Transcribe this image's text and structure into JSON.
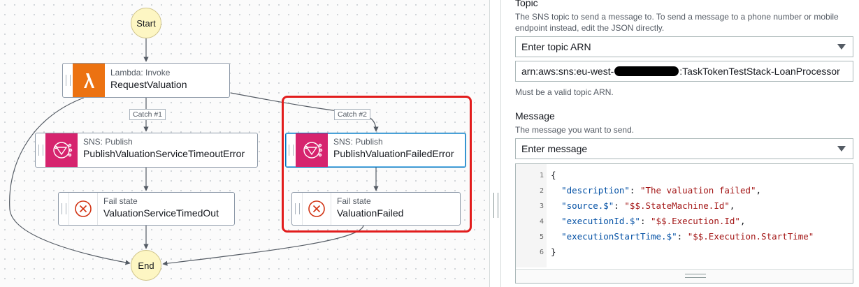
{
  "workflow": {
    "start_label": "Start",
    "end_label": "End",
    "nodes": [
      {
        "type": "Lambda: Invoke",
        "name": "RequestValuation",
        "icon": "lambda-icon"
      },
      {
        "type": "SNS: Publish",
        "name": "PublishValuationServiceTimeoutError",
        "icon": "sns-icon"
      },
      {
        "type": "SNS: Publish",
        "name": "PublishValuationFailedError",
        "icon": "sns-icon",
        "selected": true
      },
      {
        "type": "Fail state",
        "name": "ValuationServiceTimedOut",
        "icon": "fail-x-icon"
      },
      {
        "type": "Fail state",
        "name": "ValuationFailed",
        "icon": "fail-x-icon"
      }
    ],
    "catch_labels": [
      "Catch #1",
      "Catch #2"
    ],
    "highlight_color": "#e21c1c"
  },
  "form": {
    "topic": {
      "label": "Topic",
      "description": "The SNS topic to send a message to. To send a message to a phone number or mobile endpoint instead, edit the JSON directly.",
      "mode": "Enter topic ARN",
      "arn_prefix": "arn:aws:sns:eu-west-",
      "arn_suffix": ":TaskTokenTestStack-LoanProcessor",
      "hint": "Must be a valid topic ARN."
    },
    "message": {
      "label": "Message",
      "description": "The message you want to send.",
      "mode": "Enter message",
      "code_lines": [
        {
          "n": "1",
          "key": "",
          "value": "",
          "raw": "{"
        },
        {
          "n": "2",
          "key": "\"description\"",
          "value": "\"The valuation failed\"",
          "trail": ","
        },
        {
          "n": "3",
          "key": "\"source.$\"",
          "value": "\"$$.StateMachine.Id\"",
          "trail": ","
        },
        {
          "n": "4",
          "key": "\"executionId.$\"",
          "value": "\"$$.Execution.Id\"",
          "trail": ","
        },
        {
          "n": "5",
          "key": "\"executionStartTime.$\"",
          "value": "\"$$.Execution.StartTime\"",
          "trail": ""
        },
        {
          "n": "6",
          "key": "",
          "value": "",
          "raw": "}"
        }
      ]
    }
  },
  "colors": {
    "lambda": "#ec7211",
    "sns": "#d6246e",
    "circle_fill": "#fdf6c3",
    "selected_border": "#0073bb"
  }
}
